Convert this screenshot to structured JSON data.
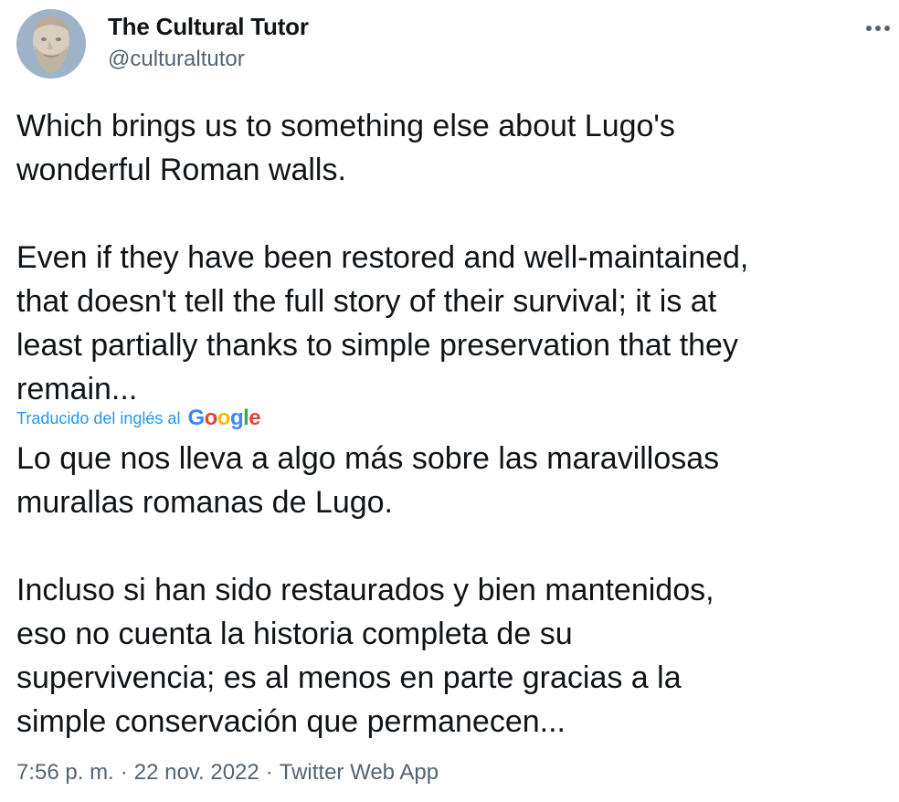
{
  "author": {
    "display_name": "The Cultural Tutor",
    "handle": "@culturaltutor",
    "avatar_icon": "bearded-statue-avatar"
  },
  "more_icon": "more-options-icon",
  "tweet": {
    "original_text": "Which brings us to something else about Lugo's\nwonderful Roman walls.\n\nEven if they have been restored and well-maintained,\nthat doesn't tell the full story of their survival; it is at\nleast partially thanks to simple preservation that they\nremain...",
    "translation_label": "Traducido del inglés al",
    "translation_provider": {
      "letters": [
        "G",
        "o",
        "o",
        "g",
        "l",
        "e"
      ],
      "colors": [
        "#4285F4",
        "#EA4335",
        "#FBBC05",
        "#4285F4",
        "#34A853",
        "#EA4335"
      ]
    },
    "translated_text": "Lo que nos lleva a algo más sobre las maravillosas\nmurallas romanas de Lugo.\n\nIncluso si han sido restaurados y bien mantenidos,\neso no cuenta la historia completa de su\nsupervivencia; es al menos en parte gracias a la\nsimple conservación que permanecen..."
  },
  "meta": {
    "time": "7:56 p. m.",
    "separator": "·",
    "date": "22 nov. 2022",
    "source": "Twitter Web App"
  },
  "colors": {
    "text": "#0f1419",
    "secondary": "#536471",
    "link": "#1d9bf0"
  }
}
